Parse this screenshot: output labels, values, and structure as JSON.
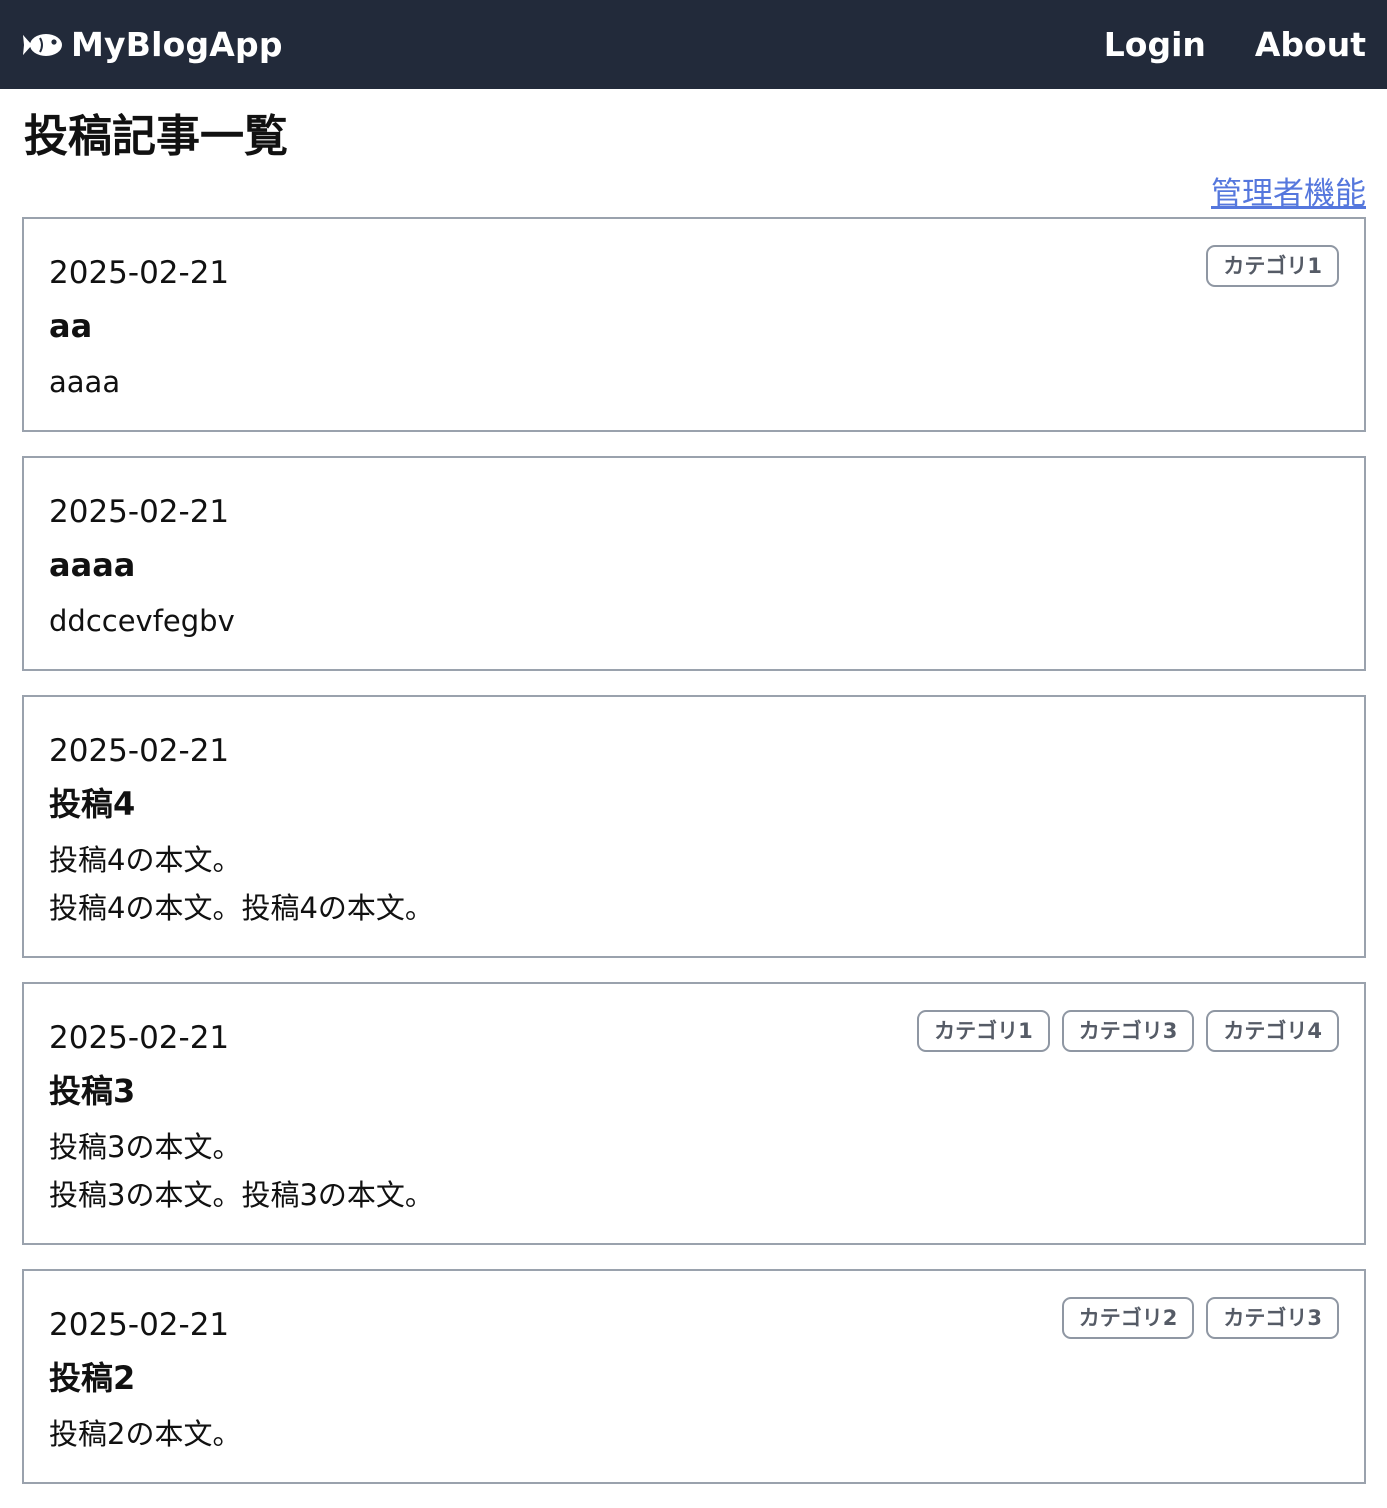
{
  "header": {
    "brand": "MyBlogApp",
    "brand_icon": "fish-icon",
    "nav": [
      {
        "label": "Login"
      },
      {
        "label": "About"
      }
    ],
    "background": "#222a3a"
  },
  "page": {
    "title": "投稿記事一覧",
    "admin_link": "管理者機能",
    "link_color": "#5577dd"
  },
  "posts": [
    {
      "date": "2025-02-21",
      "title": "aa",
      "body": "aaaa",
      "tags": [
        "カテゴリ1"
      ]
    },
    {
      "date": "2025-02-21",
      "title": "aaaa",
      "body": "ddccevfegbv",
      "tags": []
    },
    {
      "date": "2025-02-21",
      "title": "投稿4",
      "body": "投稿4の本文。\n投稿4の本文。投稿4の本文。",
      "tags": []
    },
    {
      "date": "2025-02-21",
      "title": "投稿3",
      "body": "投稿3の本文。\n投稿3の本文。投稿3の本文。",
      "tags": [
        "カテゴリ1",
        "カテゴリ3",
        "カテゴリ4"
      ]
    },
    {
      "date": "2025-02-21",
      "title": "投稿2",
      "body": "投稿2の本文。",
      "tags": [
        "カテゴリ2",
        "カテゴリ3"
      ]
    }
  ]
}
